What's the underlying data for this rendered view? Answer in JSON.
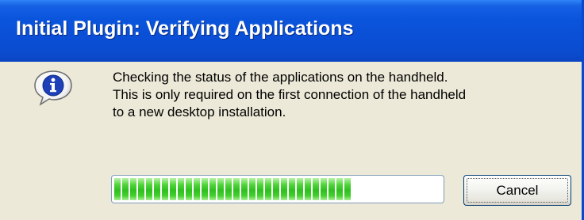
{
  "window": {
    "title": "Initial Plugin: Verifying Applications"
  },
  "icon": "info-icon",
  "message": {
    "lines": [
      "Checking the status of the applications on the handheld.",
      "This is only required on the first connection of the handheld",
      "to a new desktop installation."
    ]
  },
  "progress": {
    "percent": 73,
    "color": "#3cc82a"
  },
  "buttons": {
    "cancel_label": "Cancel"
  },
  "colors": {
    "titlebar": "#0a55dc",
    "dialog_background": "#ece9d8"
  }
}
